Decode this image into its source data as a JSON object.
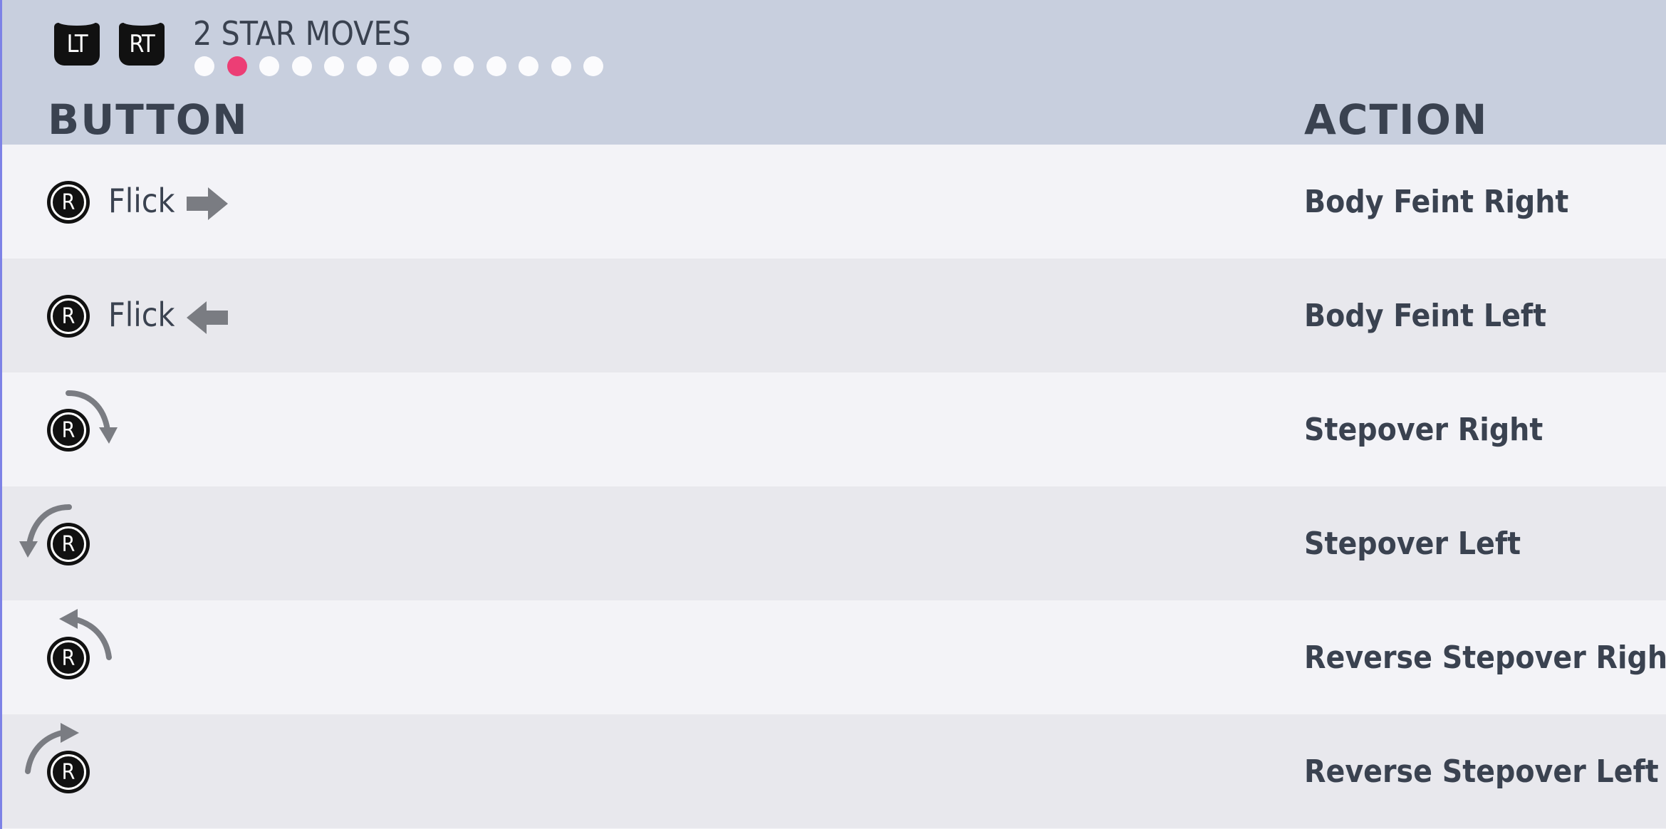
{
  "header": {
    "lt_label": "LT",
    "rt_label": "RT",
    "title": "2 STAR MOVES",
    "page_dots": 13,
    "active_page": 2
  },
  "columns": {
    "button": "BUTTON",
    "action": "ACTION"
  },
  "rows": [
    {
      "input_label": "Flick",
      "button_glyph": "R",
      "icon": "arrow-right-icon",
      "action": "Body Feint Right"
    },
    {
      "input_label": "Flick",
      "button_glyph": "R",
      "icon": "arrow-left-icon",
      "action": "Body Feint Left"
    },
    {
      "input_label": "",
      "button_glyph": "R",
      "icon": "curve-arrow-clockwise-icon",
      "action": "Stepover Right"
    },
    {
      "input_label": "",
      "button_glyph": "R",
      "icon": "curve-arrow-counterclockwise-icon",
      "action": "Stepover Left"
    },
    {
      "input_label": "",
      "button_glyph": "R",
      "icon": "curve-arrow-reverse-right-icon",
      "action": "Reverse Stepover Right"
    },
    {
      "input_label": "",
      "button_glyph": "R",
      "icon": "curve-arrow-reverse-left-icon",
      "action": "Reverse Stepover Left"
    }
  ],
  "colors": {
    "header_bg": "#c8cfde",
    "active_dot": "#ec3e75",
    "text": "#3a4250",
    "row_light": "#f3f3f7",
    "row_dark": "#e8e8ed"
  }
}
